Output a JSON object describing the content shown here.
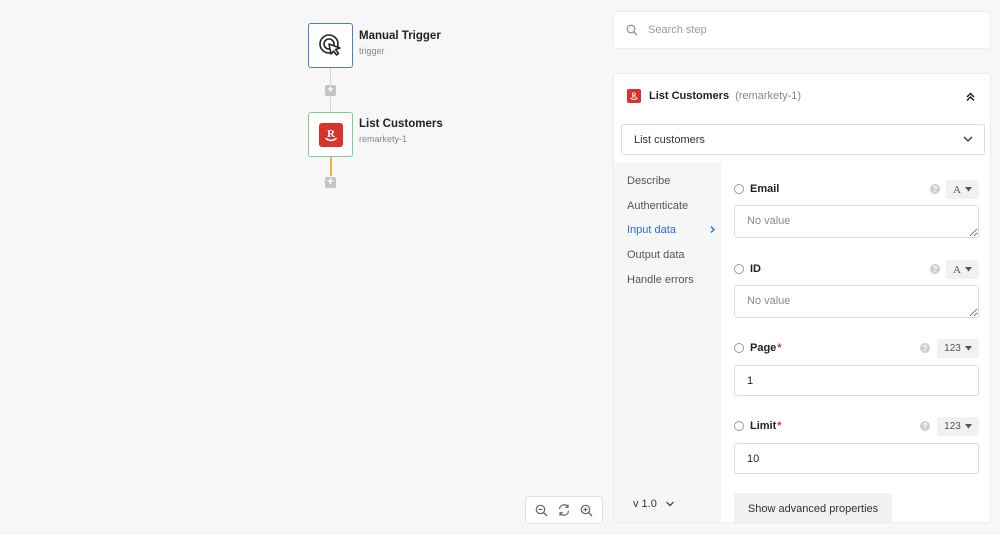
{
  "workflow": {
    "trigger": {
      "title": "Manual Trigger",
      "subtitle": "trigger",
      "icon": "cursor-click-icon"
    },
    "step": {
      "title": "List Customers",
      "subtitle": "remarkety-1",
      "icon": "remarkety-logo",
      "logo_letter": "R"
    },
    "add_step_icon": "plus-icon",
    "colors": {
      "trigger_border": "#4a7fd0",
      "step_border": "#7dcf8c",
      "connector_active": "#f4b040",
      "brand_red": "#d9342b"
    }
  },
  "zoom_controls": {
    "icons": [
      "zoom-out-icon",
      "reset-icon",
      "zoom-in-icon"
    ]
  },
  "search": {
    "placeholder": "Search step",
    "value": ""
  },
  "panel": {
    "title": "List Customers",
    "subtitle": "(remarkety-1)",
    "action": {
      "selected": "List customers"
    },
    "nav": [
      {
        "label": "Describe",
        "active": false
      },
      {
        "label": "Authenticate",
        "active": false
      },
      {
        "label": "Input data",
        "active": true
      },
      {
        "label": "Output data",
        "active": false
      },
      {
        "label": "Handle errors",
        "active": false
      }
    ],
    "version": "v 1.0",
    "fields": [
      {
        "label": "Email",
        "required": false,
        "type": "A",
        "placeholder": "No value",
        "value": ""
      },
      {
        "label": "ID",
        "required": false,
        "type": "A",
        "placeholder": "No value",
        "value": ""
      },
      {
        "label": "Page",
        "required": true,
        "type": "123",
        "placeholder": "",
        "value": "1"
      },
      {
        "label": "Limit",
        "required": true,
        "type": "123",
        "placeholder": "",
        "value": "10"
      }
    ],
    "required_mark": "*",
    "advanced_label": "Show advanced properties"
  }
}
